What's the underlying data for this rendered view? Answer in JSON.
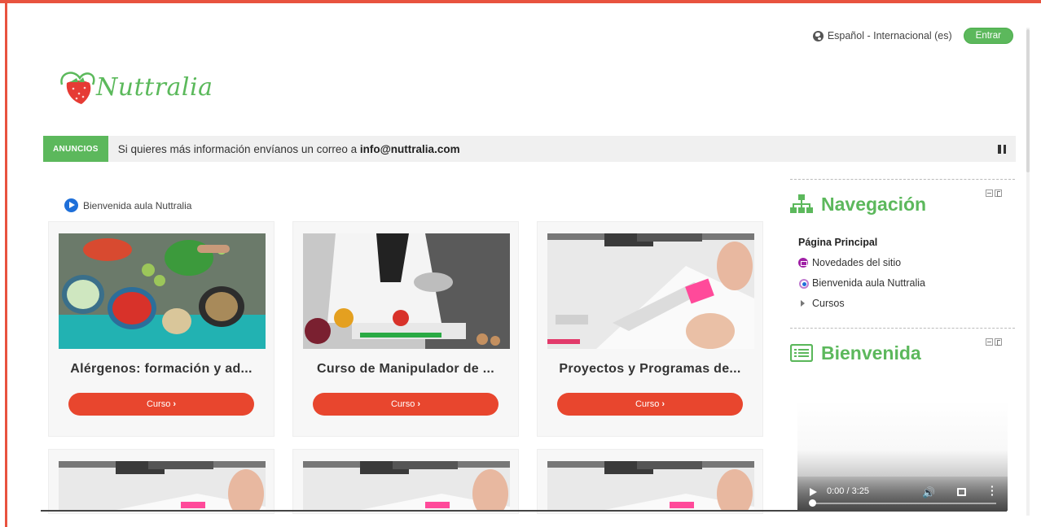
{
  "header": {
    "language": "Español - Internacional (es)",
    "login_label": "Entrar"
  },
  "logo": {
    "text": "Nuttralia"
  },
  "announcement": {
    "label": "ANUNCIOS",
    "text": "Si quieres más información envíanos un correo a ",
    "email": "info@nuttralia.com"
  },
  "breadcrumb": {
    "text": "Bienvenida aula Nuttralia"
  },
  "courses": [
    {
      "title": "Alérgenos: formación y ad...",
      "button": "Curso"
    },
    {
      "title": "Curso de Manipulador de ...",
      "button": "Curso"
    },
    {
      "title": "Proyectos y Programas de...",
      "button": "Curso"
    }
  ],
  "sidebar": {
    "navigation": {
      "title": "Navegación",
      "items": [
        {
          "label": "Página Principal"
        },
        {
          "label": "Novedades del sitio"
        },
        {
          "label": "Bienvenida aula Nuttralia"
        },
        {
          "label": "Cursos"
        }
      ]
    },
    "welcome": {
      "title": "Bienvenida"
    }
  },
  "video": {
    "time": "0:00 / 3:25"
  }
}
